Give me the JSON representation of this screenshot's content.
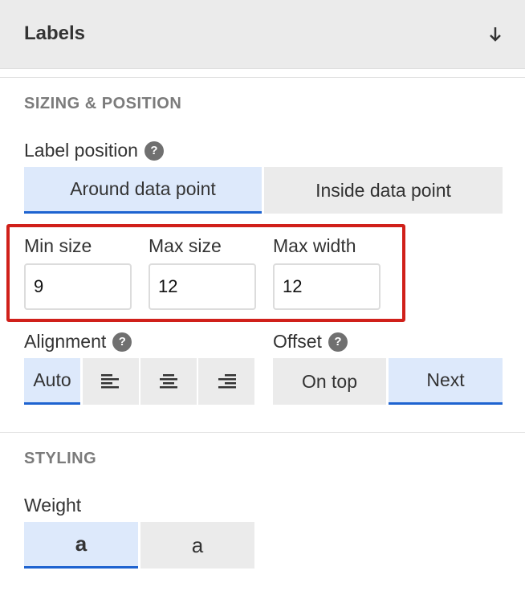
{
  "header": {
    "title": "Labels",
    "collapse_icon": "arrow-down-icon"
  },
  "sizing": {
    "section_title": "SIZING & POSITION",
    "label_position": {
      "label": "Label position",
      "help": "?",
      "options": [
        "Around data point",
        "Inside data point"
      ],
      "selected": "Around data point"
    },
    "min_size": {
      "label": "Min size",
      "value": "9"
    },
    "max_size": {
      "label": "Max size",
      "value": "12"
    },
    "max_width": {
      "label": "Max width",
      "value": "12"
    },
    "alignment": {
      "label": "Alignment",
      "help": "?",
      "options": [
        "Auto",
        "align-left-icon",
        "align-center-icon",
        "align-right-icon"
      ],
      "selected": "Auto"
    },
    "offset": {
      "label": "Offset",
      "help": "?",
      "options": [
        "On top",
        "Next"
      ],
      "selected": "Next"
    }
  },
  "styling": {
    "section_title": "STYLING",
    "weight": {
      "label": "Weight",
      "options": [
        "a",
        "a"
      ],
      "selected_index": 0
    }
  },
  "colors": {
    "accent": "#1e63d0",
    "active_bg": "#dde9fb",
    "highlight": "#d0201a"
  }
}
